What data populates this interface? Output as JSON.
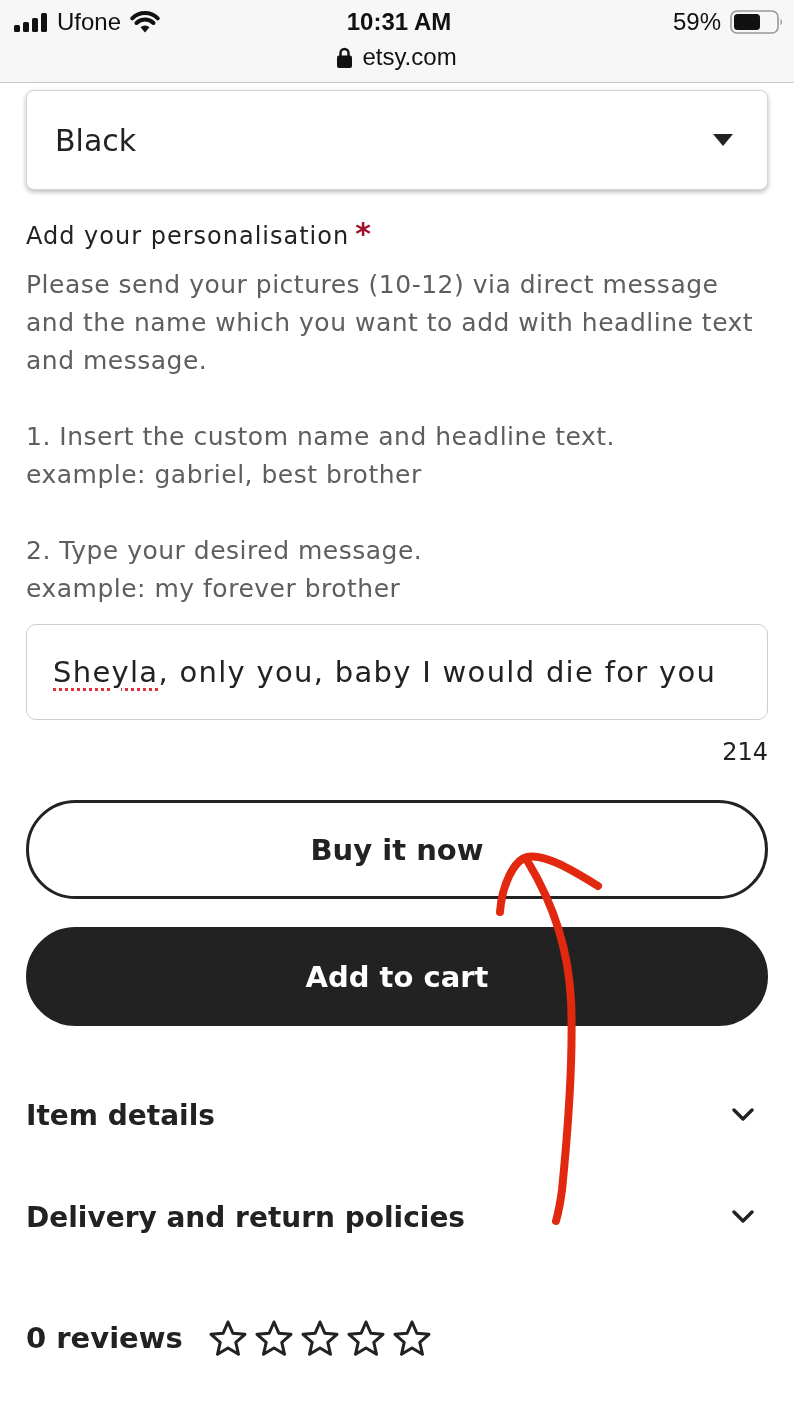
{
  "status_bar": {
    "carrier": "Ufone",
    "time": "10:31 AM",
    "battery": "59%",
    "url": "etsy.com"
  },
  "variant_select": {
    "value": "Black"
  },
  "personalisation": {
    "label": "Add your personalisation",
    "required_mark": "*",
    "instructions": [
      "Please send your pictures (10-12) via direct message and the name which you want to add with headline text and message.",
      "1. Insert the custom name and headline text.\nexample: gabriel, best brother",
      "2. Type your desired message.\nexample: my forever brother"
    ],
    "field": {
      "value": "Sheyla, only you, baby I would die for you",
      "first_word_misspelled": true
    },
    "counter": "214"
  },
  "buttons": [
    {
      "label": "Buy it now",
      "kind": "outline"
    },
    {
      "label": "Add to cart",
      "kind": "filled"
    }
  ],
  "sections": [
    {
      "title": "Item details",
      "expanded": false
    },
    {
      "title": "Delivery and return policies",
      "expanded": false
    }
  ],
  "reviews": {
    "label": "0 reviews",
    "stars": 0
  }
}
